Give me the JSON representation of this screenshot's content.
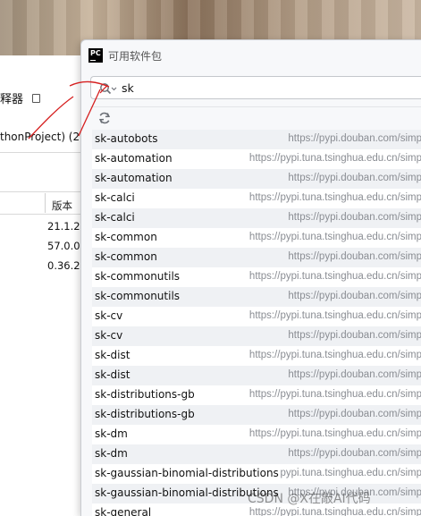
{
  "parent": {
    "interpreter_label": "释器",
    "project_label": "thonProject) (2)",
    "column_version": "版本",
    "versions": [
      "21.1.2",
      "57.0.0",
      "0.36.2"
    ]
  },
  "dialog": {
    "logo_text": "PC",
    "title": "可用软件包",
    "search": {
      "value": "sk",
      "placeholder": ""
    },
    "packages": [
      {
        "name": "sk-autobots",
        "repo": "https://pypi.douban.com/simp"
      },
      {
        "name": "sk-automation",
        "repo": "https://pypi.tuna.tsinghua.edu.cn/simp"
      },
      {
        "name": "sk-automation",
        "repo": "https://pypi.douban.com/simp"
      },
      {
        "name": "sk-calci",
        "repo": "https://pypi.tuna.tsinghua.edu.cn/simp"
      },
      {
        "name": "sk-calci",
        "repo": "https://pypi.douban.com/simp"
      },
      {
        "name": "sk-common",
        "repo": "https://pypi.tuna.tsinghua.edu.cn/simp"
      },
      {
        "name": "sk-common",
        "repo": "https://pypi.douban.com/simp"
      },
      {
        "name": "sk-commonutils",
        "repo": "https://pypi.tuna.tsinghua.edu.cn/simp"
      },
      {
        "name": "sk-commonutils",
        "repo": "https://pypi.douban.com/simp"
      },
      {
        "name": "sk-cv",
        "repo": "https://pypi.tuna.tsinghua.edu.cn/simp"
      },
      {
        "name": "sk-cv",
        "repo": "https://pypi.douban.com/simp"
      },
      {
        "name": "sk-dist",
        "repo": "https://pypi.tuna.tsinghua.edu.cn/simp"
      },
      {
        "name": "sk-dist",
        "repo": "https://pypi.douban.com/simp"
      },
      {
        "name": "sk-distributions-gb",
        "repo": "https://pypi.tuna.tsinghua.edu.cn/simp"
      },
      {
        "name": "sk-distributions-gb",
        "repo": "https://pypi.douban.com/simp"
      },
      {
        "name": "sk-dm",
        "repo": "https://pypi.tuna.tsinghua.edu.cn/simp"
      },
      {
        "name": "sk-dm",
        "repo": "https://pypi.douban.com/simp"
      },
      {
        "name": "sk-gaussian-binomial-distributions",
        "repo": "pypi.tuna.tsinghua.edu.cn/simp"
      },
      {
        "name": "sk-gaussian-binomial-distributions",
        "repo": "https://pypi.douban.com/simp"
      },
      {
        "name": "sk-general",
        "repo": "https://pypi.tuna.tsinghua.edu.cn/simp"
      }
    ]
  },
  "watermark": "CSDN @X在敲AI代码",
  "icons": {
    "logo": "pycharm-logo-icon",
    "search": "search-icon",
    "refresh": "refresh-icon",
    "settings": "window-icon"
  },
  "colors": {
    "row_alt": "#eff1f4",
    "url_text": "#8a8d93",
    "annotation": "#d62020"
  }
}
